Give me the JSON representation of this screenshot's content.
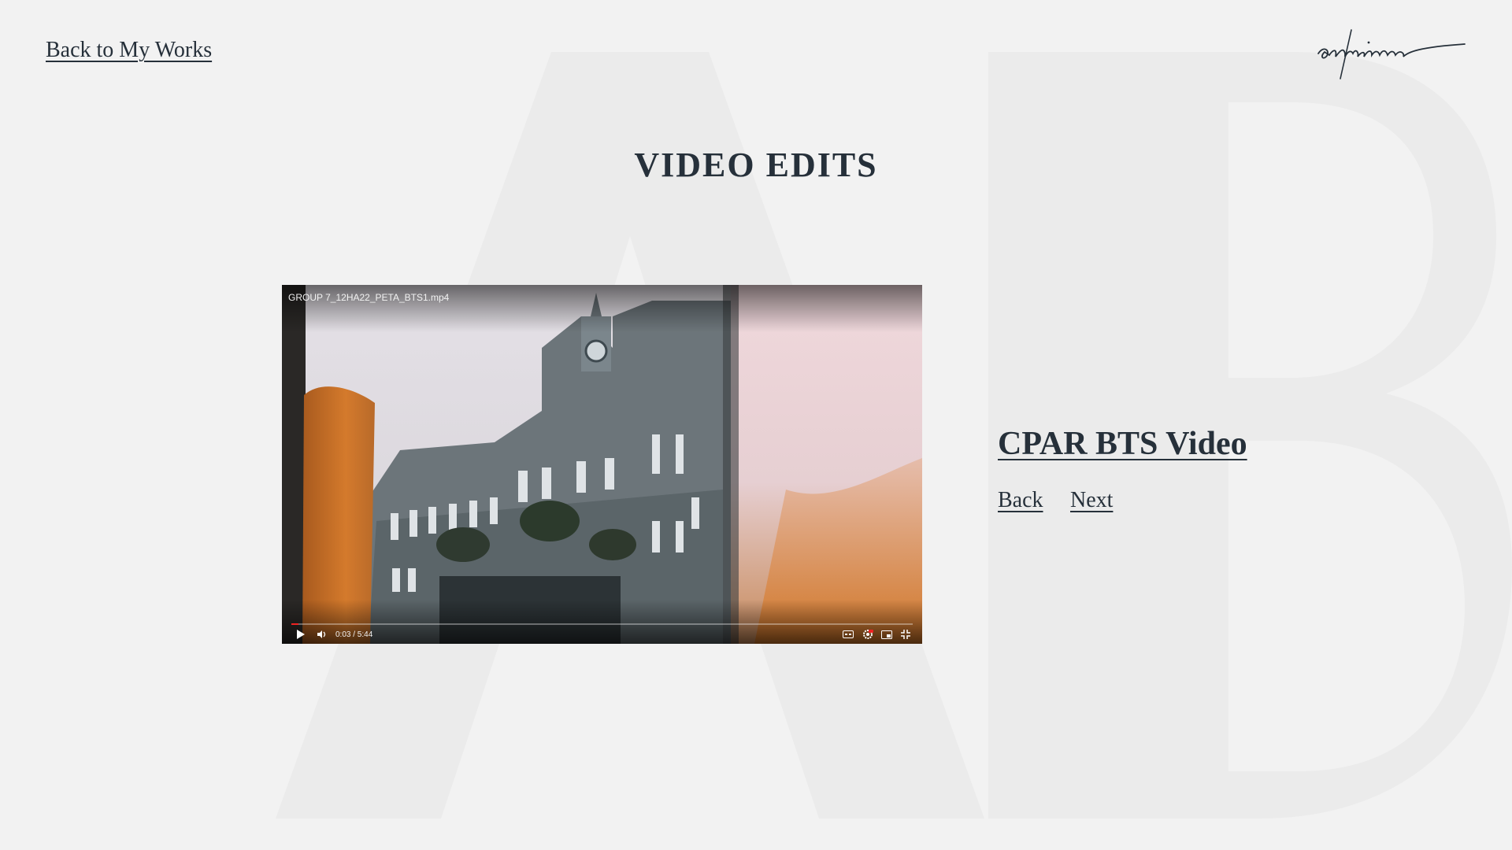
{
  "header": {
    "back_link": "Back to My Works",
    "logo_text": "adrianne"
  },
  "page_title": "VIDEO EDITS",
  "video": {
    "filename": "GROUP 7_12HA22_PETA_BTS1.mp4",
    "current_time": "0:03",
    "duration": "5:44",
    "time_display": "0:03 / 5:44",
    "progress_fraction": 0.009,
    "icons": [
      "play-icon",
      "volume-icon",
      "captions-icon",
      "settings-icon",
      "miniplayer-icon",
      "exit-fullscreen-icon"
    ]
  },
  "item": {
    "title": "CPAR BTS Video",
    "back_label": "Back",
    "next_label": "Next"
  },
  "colors": {
    "background": "#f2f2f2",
    "text": "#26303a",
    "monogram": "#e9e9e9",
    "progress": "#e22222"
  }
}
